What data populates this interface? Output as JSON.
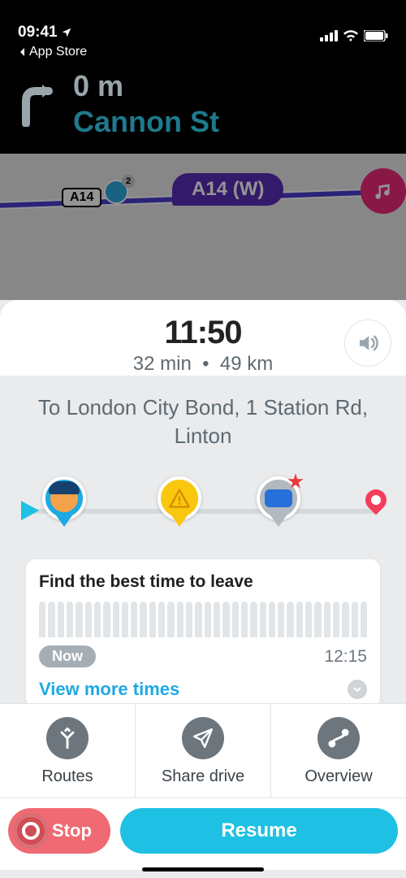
{
  "status": {
    "time": "09:41",
    "back_label": "App Store"
  },
  "direction": {
    "distance": "0 m",
    "street": "Cannon St"
  },
  "map": {
    "shield": "A14",
    "bubble": "A14 (W)",
    "police_count": "2"
  },
  "eta": {
    "arrival": "11:50",
    "duration": "32 min",
    "distance": "49 km"
  },
  "destination": {
    "line": "To London City Bond, 1 Station Rd, Linton"
  },
  "best_time": {
    "title": "Find the best time to leave",
    "now_label": "Now",
    "end_time": "12:15",
    "view_more": "View more times"
  },
  "actions": {
    "routes": "Routes",
    "share": "Share drive",
    "overview": "Overview"
  },
  "buttons": {
    "stop": "Stop",
    "resume": "Resume"
  }
}
